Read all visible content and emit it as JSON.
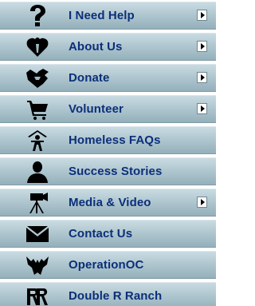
{
  "menu": {
    "items": [
      {
        "label": "I Need Help",
        "icon": "question-mark-icon",
        "has_submenu": true
      },
      {
        "label": "About Us",
        "icon": "heart-icon",
        "has_submenu": true
      },
      {
        "label": "Donate",
        "icon": "helping-hand-icon",
        "has_submenu": true
      },
      {
        "label": "Volunteer",
        "icon": "cart-icon",
        "has_submenu": true
      },
      {
        "label": "Homeless FAQs",
        "icon": "homeless-person-icon",
        "has_submenu": false
      },
      {
        "label": "Success Stories",
        "icon": "person-silhouette-icon",
        "has_submenu": false
      },
      {
        "label": "Media & Video",
        "icon": "video-camera-icon",
        "has_submenu": true
      },
      {
        "label": "Contact Us",
        "icon": "envelope-icon",
        "has_submenu": false
      },
      {
        "label": "OperationOC",
        "icon": "eagle-icon",
        "has_submenu": false
      },
      {
        "label": "Double R Ranch",
        "icon": "rr-logo-icon",
        "has_submenu": false
      }
    ]
  },
  "colors": {
    "label_text": "#0b2f7a",
    "button_gradient_top": "#c9dbe2",
    "button_gradient_bottom": "#94b0bb",
    "icon_fill": "#000000"
  }
}
